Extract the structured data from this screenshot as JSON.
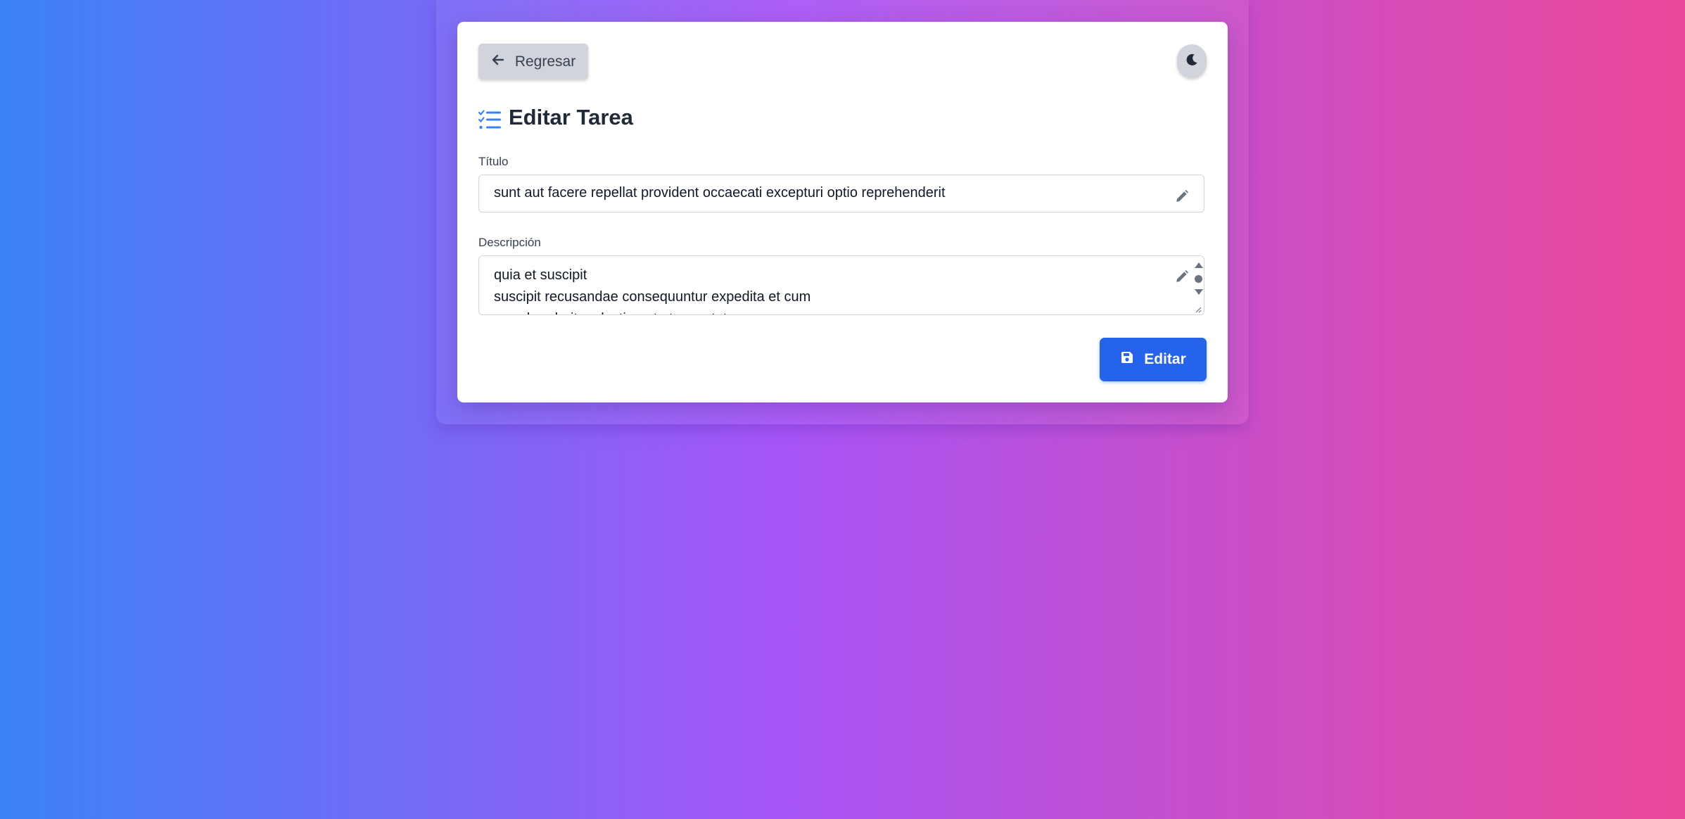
{
  "colors": {
    "primary": "#2563eb",
    "heading_icon": "#3b82f6",
    "button_gray": "#d1d5db",
    "gradient": [
      "#3b82f6",
      "#a855f7",
      "#ec4899"
    ]
  },
  "header": {
    "back_label": "Regresar",
    "back_icon": "arrow-left-icon",
    "theme_icon": "moon-icon"
  },
  "form": {
    "heading": "Editar Tarea",
    "heading_icon": "list-check-icon",
    "title_label": "Título",
    "title_value": "sunt aut facere repellat provident occaecati excepturi optio reprehenderit",
    "description_label": "Descripción",
    "description_lines": [
      "quia et suscipit",
      "suscipit recusandae consequuntur expedita et cum",
      "reprehenderit molestiae ut ut quas totam"
    ],
    "edit_icon": "pencil-icon",
    "submit_label": "Editar",
    "submit_icon": "floppy-disk-icon"
  }
}
